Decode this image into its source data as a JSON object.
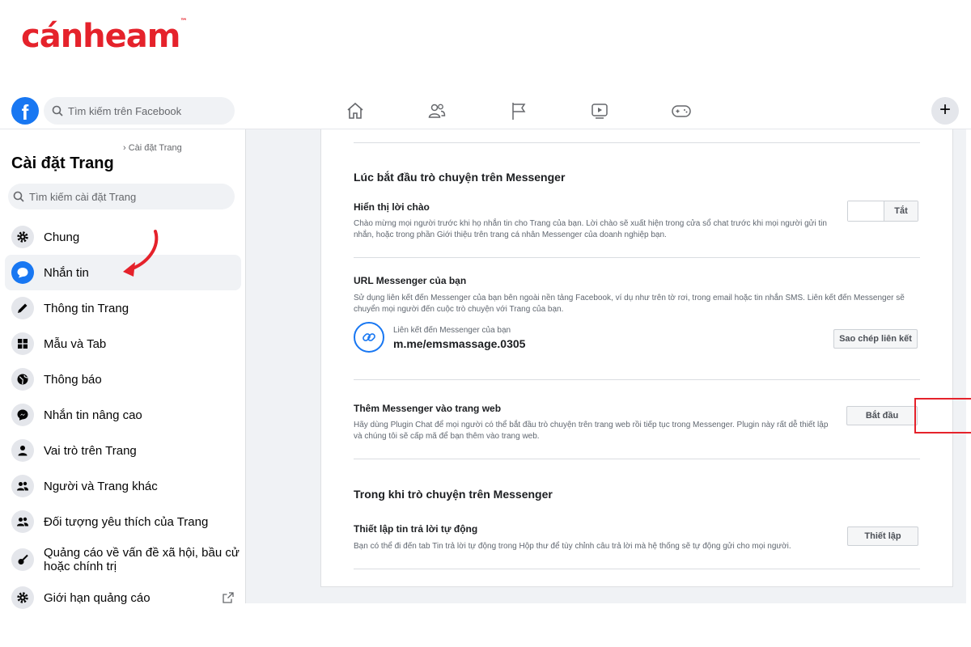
{
  "brand": {
    "logo_text": "cánheam",
    "trademark": "™"
  },
  "topbar": {
    "logo_letter": "f",
    "search_placeholder": "Tìm kiếm trên Facebook",
    "nav_icons": [
      "home-icon",
      "friends-icon",
      "pages-flag-icon",
      "watch-icon",
      "gaming-icon"
    ],
    "plus_label": "+"
  },
  "sidebar": {
    "breadcrumb": "› Cài đặt Trang",
    "title": "Cài đặt Trang",
    "search_placeholder": "Tìm kiếm cài đặt Trang",
    "items": [
      {
        "label": "Chung",
        "icon": "gear-icon"
      },
      {
        "label": "Nhắn tin",
        "icon": "chat-bubble-icon",
        "active": true
      },
      {
        "label": "Thông tin Trang",
        "icon": "pencil-icon"
      },
      {
        "label": "Mẫu và Tab",
        "icon": "grid-icon"
      },
      {
        "label": "Thông báo",
        "icon": "globe-icon"
      },
      {
        "label": "Nhắn tin nâng cao",
        "icon": "messenger-icon"
      },
      {
        "label": "Vai trò trên Trang",
        "icon": "person-icon"
      },
      {
        "label": "Người và Trang khác",
        "icon": "people-icon"
      },
      {
        "label": "Đối tượng yêu thích của Trang",
        "icon": "people-icon"
      },
      {
        "label": "Quảng cáo về vấn đề xã hội, bầu cử hoặc chính trị",
        "icon": "guitar-icon"
      },
      {
        "label": "Giới hạn quảng cáo",
        "icon": "gear-icon",
        "external": true
      }
    ]
  },
  "main": {
    "section1_title": "Lúc bắt đầu trò chuyện trên Messenger",
    "greeting": {
      "title": "Hiển thị lời chào",
      "desc": "Chào mừng mọi người trước khi họ nhắn tin cho Trang của bạn. Lời chào sẽ xuất hiện trong cửa sổ chat trước khi mọi người gửi tin nhắn, hoặc trong phần Giới thiệu trên trang cá nhân Messenger của doanh nghiệp bạn.",
      "toggle_label": "Tắt"
    },
    "url": {
      "title": "URL Messenger của bạn",
      "desc": "Sử dụng liên kết đến Messenger của bạn bên ngoài nền tảng Facebook, ví dụ như trên tờ rơi, trong email hoặc tin nhắn SMS. Liên kết đến Messenger sẽ chuyển mọi người đến cuộc trò chuyện với Trang của bạn.",
      "link_caption": "Liên kết đến Messenger của bạn",
      "link_value": "m.me/emsmassage.0305",
      "copy_button": "Sao chép liên kết"
    },
    "website": {
      "title": "Thêm Messenger vào trang web",
      "desc": "Hãy dùng Plugin Chat để mọi người có thể bắt đầu trò chuyện trên trang web rồi tiếp tục trong Messenger. Plugin này rất dễ thiết lập và chúng tôi sẽ cấp mã để bạn thêm vào trang web.",
      "start_button": "Bắt đầu"
    },
    "section2_title": "Trong khi trò chuyện trên Messenger",
    "auto_reply": {
      "title": "Thiết lập tin trả lời tự động",
      "desc": "Bạn có thể đi đến tab Tin trả lời tự động trong Hộp thư để tùy chỉnh câu trả lời mà hệ thống sẽ tự động gửi cho mọi người.",
      "setup_button": "Thiết lập"
    }
  },
  "colors": {
    "facebook_blue": "#1877f2",
    "highlight_red": "#e5222b"
  }
}
